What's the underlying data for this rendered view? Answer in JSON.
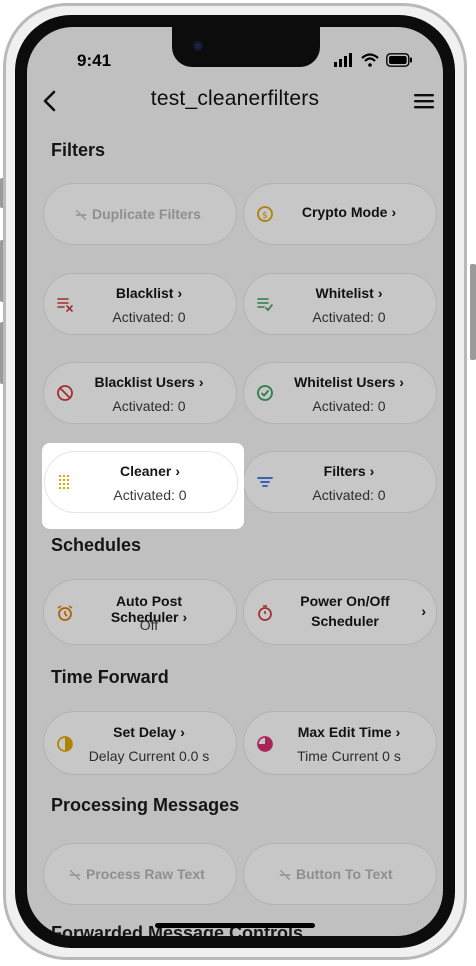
{
  "status": {
    "time": "9:41"
  },
  "header": {
    "title": "test_cleanerfilters"
  },
  "sections": {
    "filters": "Filters",
    "schedules": "Schedules",
    "time_forward": "Time Forward",
    "processing": "Processing Messages",
    "forwarded": "Forwarded Message Controls"
  },
  "cards": {
    "duplicate": {
      "label": "Duplicate Filters"
    },
    "crypto": {
      "label": "Crypto Mode"
    },
    "blacklist": {
      "label": "Blacklist",
      "sub": "Activated: 0"
    },
    "whitelist": {
      "label": "Whitelist",
      "sub": "Activated: 0"
    },
    "blacklist_users": {
      "label": "Blacklist Users",
      "sub": "Activated: 0"
    },
    "whitelist_users": {
      "label": "Whitelist Users",
      "sub": "Activated: 0"
    },
    "cleaner": {
      "label": "Cleaner",
      "sub": "Activated: 0"
    },
    "filters": {
      "label": "Filters",
      "sub": "Activated: 0"
    },
    "auto_post": {
      "label": "Auto Post Scheduler",
      "sub": "Off"
    },
    "power": {
      "label_line1": "Power On/Off",
      "label_line2": "Scheduler"
    },
    "set_delay": {
      "label": "Set Delay",
      "sub": "Delay Current 0.0 s"
    },
    "max_edit": {
      "label": "Max Edit Time",
      "sub": "Time Current 0 s"
    },
    "raw_text": {
      "label": "Process Raw Text"
    },
    "button_text": {
      "label": "Button To Text"
    }
  },
  "chevron": "›",
  "colors": {
    "accent_yellow": "#e0a800",
    "red": "#d23b3b",
    "green": "#3aa05a",
    "blue": "#2a6fe0",
    "orange": "#e07a00",
    "magenta": "#d6336c"
  }
}
